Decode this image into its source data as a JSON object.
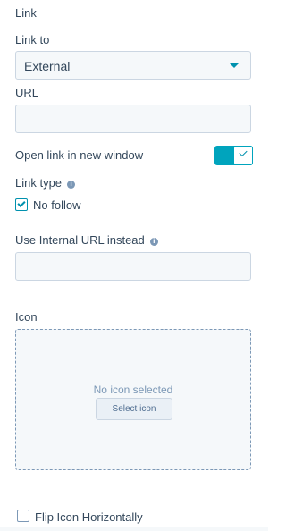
{
  "section_label": "Link",
  "link_to": {
    "label": "Link to",
    "selected": "External"
  },
  "url": {
    "label": "URL",
    "value": "",
    "placeholder": ""
  },
  "open_new_window": {
    "label": "Open link in new window",
    "enabled": true
  },
  "link_type": {
    "label": "Link type",
    "info_icon": "info-icon",
    "no_follow": {
      "label": "No follow",
      "checked": true
    }
  },
  "internal_url": {
    "label": "Use Internal URL instead",
    "info_icon": "info-icon",
    "value": "",
    "placeholder": ""
  },
  "icon": {
    "label": "Icon",
    "empty_text": "No icon selected",
    "select_button_label": "Select icon"
  },
  "flip_icon": {
    "label": "Flip Icon Horizontally",
    "checked": false
  },
  "colors": {
    "accent": "#00a4bd",
    "text": "#33475b",
    "field_bg": "#f5f8fa",
    "field_border": "#cbd6e2"
  }
}
